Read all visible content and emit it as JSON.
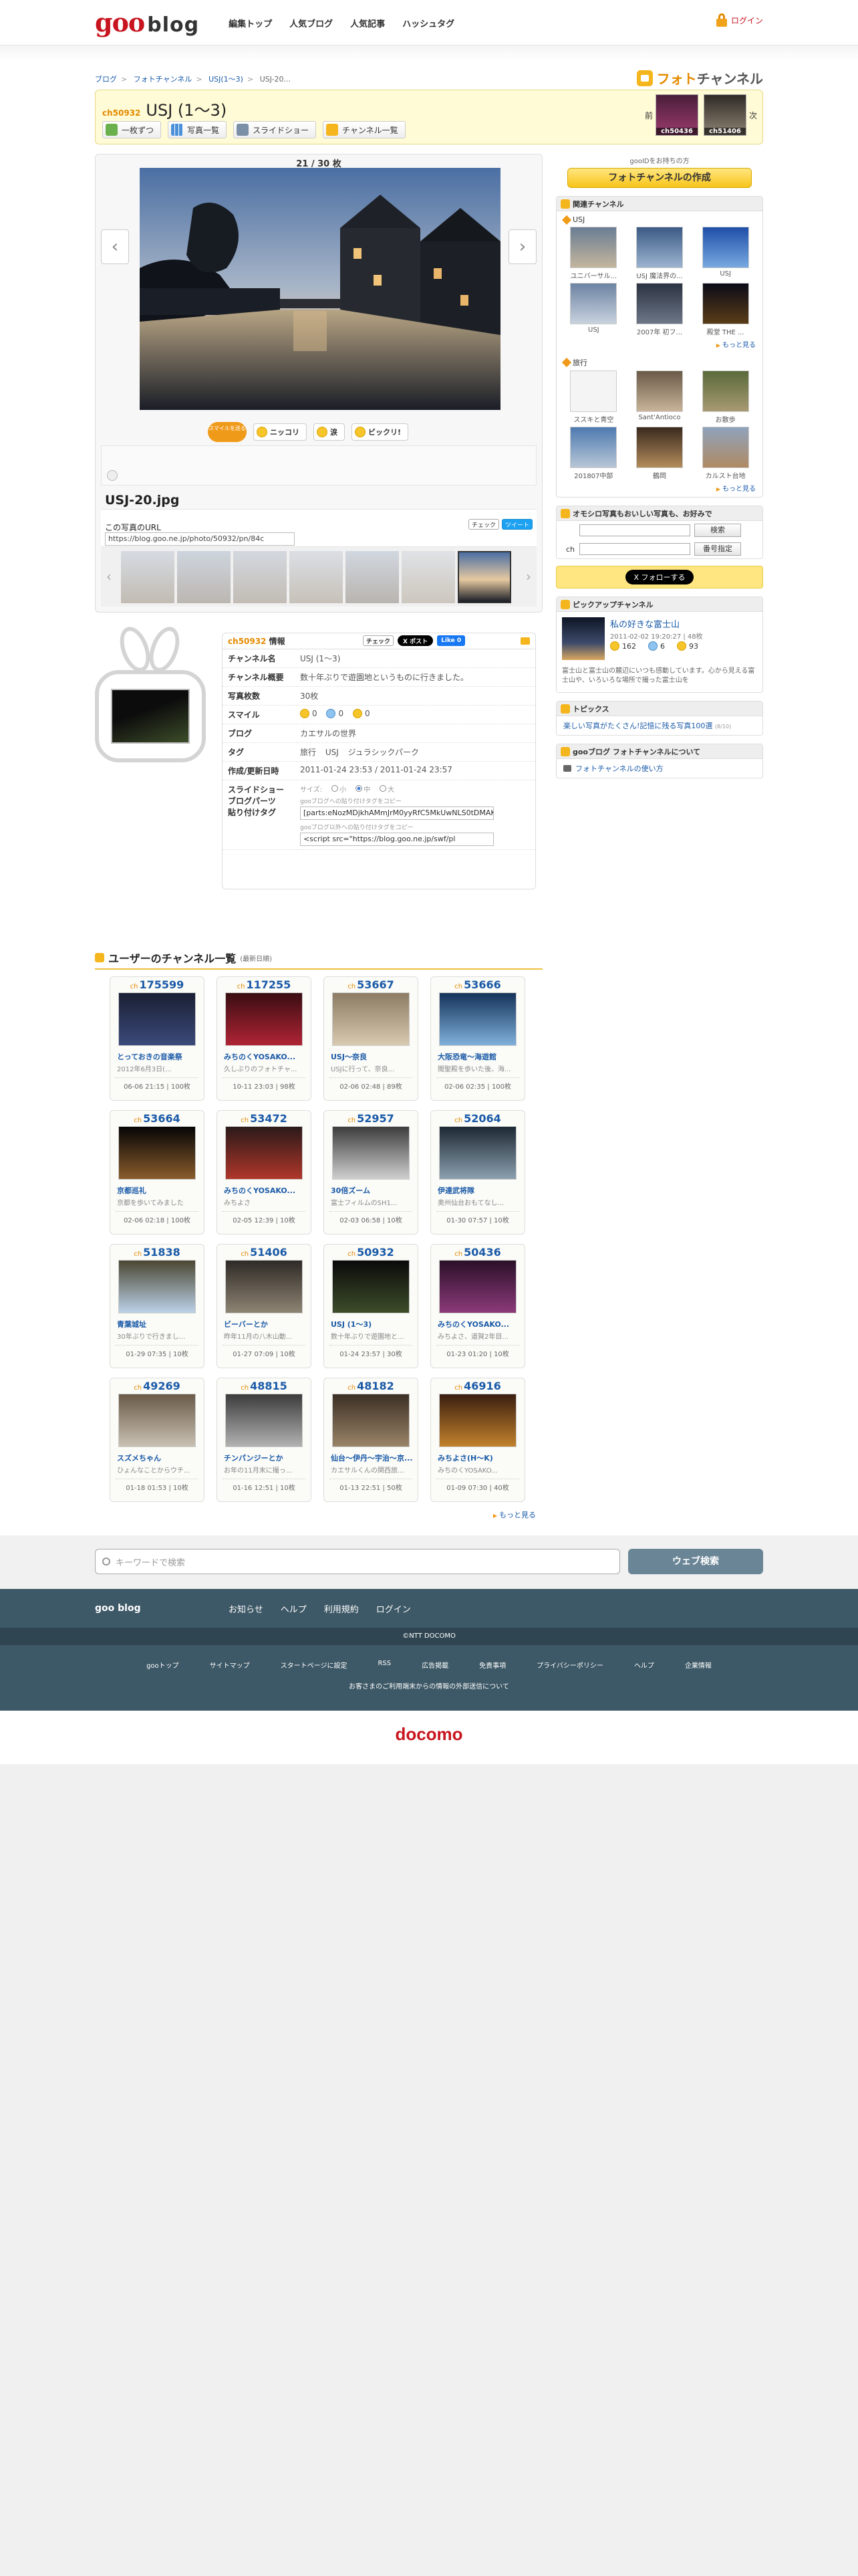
{
  "header": {
    "logo_goo": "goo",
    "logo_blog": "blog",
    "nav": [
      "編集トップ",
      "人気ブログ",
      "人気記事",
      "ハッシュタグ"
    ],
    "login": "ログイン"
  },
  "breadcrumb": [
    "ブログ",
    "フォトチャンネル",
    "USJ(1〜3)",
    "USJ-20..."
  ],
  "brand": {
    "photo": "フォト",
    "channel": "チャンネル"
  },
  "title": {
    "ch_no": "ch50932",
    "name": "USJ (1〜3)",
    "buttons": [
      "一枚ずつ",
      "写真一覧",
      "スライドショー",
      "チャンネル一覧"
    ],
    "prev": "前",
    "next": "次",
    "prev_ch": "ch50436",
    "next_ch": "ch51406"
  },
  "viewer": {
    "count": "21 / 30 枚",
    "prev_arrow": "‹",
    "next_arrow": "›",
    "mood_badge": "スマイルを送る",
    "mood_buttons": [
      "ニッコリ",
      "涙",
      "ビックリ!"
    ],
    "filename": "USJ-20.jpg",
    "url_label": "この写真のURL",
    "url_value": "https://blog.goo.ne.jp/photo/50932/pn/84c",
    "share": [
      "チェック",
      "ツイート"
    ]
  },
  "info": {
    "head": "ch50932",
    "head_suffix": "情報",
    "check": "チェック",
    "post": "X ポスト",
    "like": "Like 0",
    "rows": {
      "channel_name_k": "チャンネル名",
      "channel_name_v": "USJ (1〜3)",
      "summary_k": "チャンネル概要",
      "summary_v": "数十年ぶりで遊園地というものに行きました。",
      "count_k": "写真枚数",
      "count_v": "30枚",
      "smile_k": "スマイル",
      "smile_vals": [
        "0",
        "0",
        "0"
      ],
      "blog_k": "ブログ",
      "blog_v": "カエサルの世界",
      "tags_k": "タグ",
      "tags_v": [
        "旅行",
        "USJ",
        "ジュラシックパーク"
      ],
      "date_k": "作成/更新日時",
      "date_v": "2011-01-24 23:53 / 2011-01-24 23:57",
      "ss_k": "スライドショー",
      "parts_k": "ブログパーツ",
      "paste_k": "貼り付けタグ",
      "size_label": "サイズ:",
      "sizes": [
        "小",
        "中",
        "大"
      ],
      "code1_label": "gooブログへの貼り付けタグをコピー",
      "code1": "[parts:eNozMDjkhAMmJrM0yyRfC5MkUwNLS0tDMAKMkBIAq",
      "code2_label": "gooブログ以外への貼り付けタグをコピー",
      "code2": "<script src=\"https://blog.goo.ne.jp/swf/pl"
    }
  },
  "right": {
    "note": "gooIDをお持ちの方",
    "create": "フォトチャンネルの作成",
    "related_h": "関連チャンネル",
    "usj_h": "USJ",
    "usj": [
      "ユニバーサル...",
      "USJ 魔法界の...",
      "USJ",
      "USJ",
      "2007年 初フ...",
      "殿堂 THE ..."
    ],
    "travel_h": "旅行",
    "travel": [
      "ススキと青空",
      "Sant'Antioco",
      "お散歩",
      "201807中部",
      "鶴岡",
      "カルスト台地"
    ],
    "more": "もっと見る",
    "search_h": "オモシロ写真もおいしい写真も、お好みで",
    "search_btn": "検索",
    "ch_label": "ch",
    "num_btn": "番号指定",
    "follow": "X フォローする",
    "pickup_h": "ピックアップチャンネル",
    "pickup_title": "私の好きな富士山",
    "pickup_date": "2011-02-02 19:20:27 | 48枚",
    "pickup_smiles": [
      "162",
      "6",
      "93"
    ],
    "pickup_desc": "富士山と富士山の麓辺にいつも感動しています。心から見える富士山や、いろいろな場所で撮った富士山を",
    "topics_h": "トピックス",
    "topic": "楽しい写真がたくさん!記憶に残る写真100選",
    "topic_date": "(8/10)",
    "about_h": "gooブログ フォトチャンネルについて",
    "about": "フォトチャンネルの使い方"
  },
  "users": {
    "title": "ユーザーのチャンネル一覧",
    "sub": "(最新日順)",
    "ch_prefix": "ch",
    "cards": [
      {
        "no": "175599",
        "name": "とっておきの音楽祭",
        "desc": "2012年6月3日(...",
        "meta": "06-06 21:15 | 100枚",
        "c1": "#1a1f33",
        "c2": "#3b4a7a"
      },
      {
        "no": "117255",
        "name": "みちのくYOSAKO...",
        "desc": "久しぶりのフォトチャ...",
        "meta": "10-11 23:03 | 98枚",
        "c1": "#3a0d12",
        "c2": "#b02435"
      },
      {
        "no": "53667",
        "name": "USJ〜奈良",
        "desc": "USJに行って、奈良...",
        "meta": "02-06 02:48 | 89枚",
        "c1": "#8d7b64",
        "c2": "#d8cab0"
      },
      {
        "no": "53666",
        "name": "大阪恐竜〜海遊館",
        "desc": "聞聖殿を歩いた後、海...",
        "meta": "02-06 02:35 | 100枚",
        "c1": "#15335a",
        "c2": "#7fb0db"
      },
      {
        "no": "53664",
        "name": "京都巡礼",
        "desc": "京都を歩いてみました",
        "meta": "02-06 02:18 | 100枚",
        "c1": "#050505",
        "c2": "#8a5c2c"
      },
      {
        "no": "53472",
        "name": "みちのくYOSAKO...",
        "desc": "みちよさ",
        "meta": "02-05 12:39 | 10枚",
        "c1": "#2b1a1a",
        "c2": "#b0362a"
      },
      {
        "no": "52957",
        "name": "30倍ズーム",
        "desc": "富士フィルムのSH1...",
        "meta": "02-03 06:58 | 10枚",
        "c1": "#3d3d3d",
        "c2": "#cfcfcf"
      },
      {
        "no": "52064",
        "name": "伊達武将隊",
        "desc": "奥州仙台おもてなし...",
        "meta": "01-30 07:57 | 10枚",
        "c1": "#1d2933",
        "c2": "#8ca0b0"
      },
      {
        "no": "51838",
        "name": "青葉城址",
        "desc": "30年ぶりで行きまし...",
        "meta": "01-29 07:35 | 10枚",
        "c1": "#4a4632",
        "c2": "#bcd2e8"
      },
      {
        "no": "51406",
        "name": "ビーバーとか",
        "desc": "昨年11月の八木山動...",
        "meta": "01-27 07:09 | 10枚",
        "c1": "#2e2a26",
        "c2": "#8f8473"
      },
      {
        "no": "50932",
        "name": "USJ (1〜3)",
        "desc": "数十年ぶりで遊園地と...",
        "meta": "01-24 23:57 | 30枚",
        "c1": "#0a0a0a",
        "c2": "#3d4d2a"
      },
      {
        "no": "50436",
        "name": "みちのくYOSAKO...",
        "desc": "みちよさ、道賀2年目...",
        "meta": "01-23 01:20 | 10枚",
        "c1": "#2a1028",
        "c2": "#8c3a7a"
      },
      {
        "no": "49269",
        "name": "スズメちゃん",
        "desc": "ひょんなことからウチ...",
        "meta": "01-18 01:53 | 10枚",
        "c1": "#6a5a48",
        "c2": "#c9c1b3"
      },
      {
        "no": "48815",
        "name": "チンパンジーとか",
        "desc": "お年の11月末に撮っ...",
        "meta": "01-16 12:51 | 10枚",
        "c1": "#3c3c3c",
        "c2": "#b2b2b2"
      },
      {
        "no": "48182",
        "name": "仙台〜伊丹〜宇治〜京...",
        "desc": "カエサルくんの関西旅...",
        "meta": "01-13 22:51 | 50枚",
        "c1": "#3c2f24",
        "c2": "#9a8468"
      },
      {
        "no": "46916",
        "name": "みちよさ(H〜K)",
        "desc": "みちのくYOSAKO...",
        "meta": "01-09 07:30 | 40枚",
        "c1": "#3a1e10",
        "c2": "#c2822c"
      }
    ],
    "more": "もっと見る"
  },
  "footer": {
    "search_placeholder": "キーワードで検索",
    "search_btn": "ウェブ検索",
    "brand": "goo blog",
    "nav": [
      "お知らせ",
      "ヘルプ",
      "利用規約",
      "ログイン"
    ],
    "copyright": "©NTT DOCOMO",
    "links": [
      "gooトップ",
      "サイトマップ",
      "スタートページに設定",
      "RSS",
      "広告掲載",
      "免責事項",
      "プライバシーポリシー",
      "ヘルプ",
      "企業情報"
    ],
    "note": "お客さまのご利用端末からの情報の外部送信について",
    "docomo": "docomo"
  },
  "colors": {
    "accent": "#f5b51c",
    "brand_red": "#c8141e",
    "link": "#1a5aa8",
    "footer_bg": "#3d5866"
  }
}
